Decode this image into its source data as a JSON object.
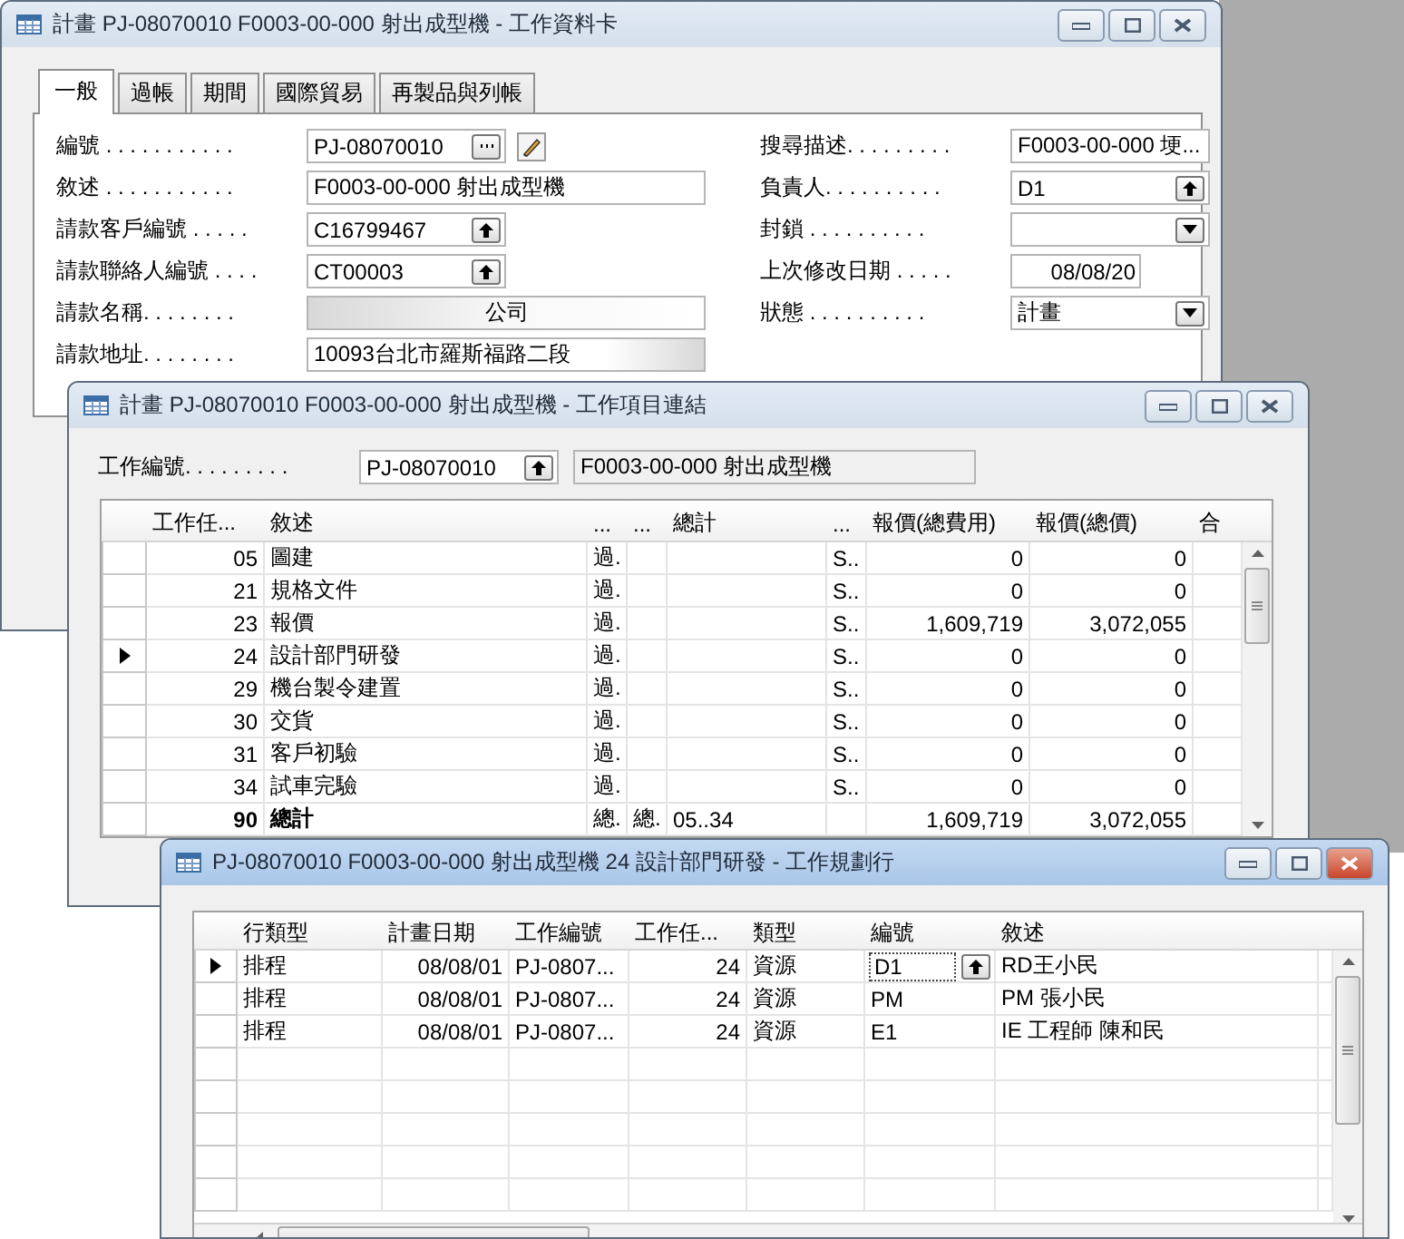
{
  "card_window": {
    "title": "計畫 PJ-08070010 F0003-00-000 射出成型機 - 工作資料卡",
    "active": false,
    "tabs": [
      {
        "label": "一般",
        "selected": true
      },
      {
        "label": "過帳",
        "selected": false
      },
      {
        "label": "期間",
        "selected": false
      },
      {
        "label": "國際貿易",
        "selected": false
      },
      {
        "label": "再製品與列帳",
        "selected": false
      }
    ],
    "left_fields": [
      {
        "label": "編號 . . . . . . . . . . .",
        "value": "PJ-08070010",
        "kind": "assist"
      },
      {
        "label": "敘述 . . . . . . . . . . .",
        "value": "F0003-00-000 射出成型機",
        "kind": "text"
      },
      {
        "label": "請款客戶編號 . . . . .",
        "value": "C16799467",
        "kind": "lookup"
      },
      {
        "label": "請款聯絡人編號 . . . .",
        "value": "CT00003",
        "kind": "lookup"
      },
      {
        "label": "請款名稱. . . . . . . .",
        "value": "公司",
        "kind": "readonly"
      },
      {
        "label": "請款地址. . . . . . . .",
        "value": "10093台北市羅斯福路二段",
        "kind": "text"
      }
    ],
    "right_fields": [
      {
        "label": "搜尋描述. . . . . . . . .",
        "value": "F0003-00-000 埂...",
        "kind": "text"
      },
      {
        "label": "負責人. . . . . . . . . .",
        "value": "D1",
        "kind": "lookup"
      },
      {
        "label": "封鎖 . . . . . . . . . .",
        "kind": "dropdown"
      },
      {
        "label": "上次修改日期 . . . . .",
        "value": "08/08/20",
        "kind": "date"
      },
      {
        "label": "狀態 . . . . . . . . . .",
        "value": "計畫",
        "kind": "dropdown"
      }
    ]
  },
  "lines_window": {
    "title": "計畫 PJ-08070010 F0003-00-000 射出成型機 - 工作項目連結",
    "active": false,
    "job_label": "工作編號. . . . . . . . .",
    "job_value": "PJ-08070010",
    "job_description": "F0003-00-000 射出成型機",
    "columns": [
      "工作任...",
      "敘述",
      "...",
      "...",
      "總計",
      "...",
      "報價(總費用)",
      "報價(總價)",
      "合"
    ],
    "rows": [
      {
        "cells": [
          "05",
          "圖建",
          "過.",
          null,
          null,
          "S..",
          "0",
          "0",
          null
        ],
        "current": false,
        "kind": "item"
      },
      {
        "cells": [
          "21",
          "規格文件",
          "過.",
          null,
          null,
          "S..",
          "0",
          "0",
          null
        ],
        "current": false,
        "kind": "item"
      },
      {
        "cells": [
          "23",
          "報價",
          "過.",
          null,
          null,
          "S..",
          "1,609,719",
          "3,072,055",
          null
        ],
        "current": false,
        "kind": "item"
      },
      {
        "cells": [
          "24",
          "設計部門研發",
          "過.",
          null,
          null,
          "S..",
          "0",
          "0",
          null
        ],
        "current": true,
        "kind": "item"
      },
      {
        "cells": [
          "29",
          "機台製令建置",
          "過.",
          null,
          null,
          "S..",
          "0",
          "0",
          null
        ],
        "current": false,
        "kind": "item"
      },
      {
        "cells": [
          "30",
          "交貨",
          "過.",
          null,
          null,
          "S..",
          "0",
          "0",
          null
        ],
        "current": false,
        "kind": "item"
      },
      {
        "cells": [
          "31",
          "客戶初驗",
          "過.",
          null,
          null,
          "S..",
          "0",
          "0",
          null
        ],
        "current": false,
        "kind": "item"
      },
      {
        "cells": [
          "34",
          "試車完驗",
          "過.",
          null,
          null,
          "S..",
          "0",
          "0",
          null
        ],
        "current": false,
        "kind": "item"
      },
      {
        "cells": [
          "90",
          "總計",
          "總.",
          "總.",
          "05..34",
          null,
          "1,609,719",
          "3,072,055",
          null
        ],
        "current": false,
        "kind": "total"
      }
    ]
  },
  "planning_window": {
    "title": "PJ-08070010 F0003-00-000 射出成型機 24 設計部門研發 - 工作規劃行",
    "active": true,
    "columns": [
      "行類型",
      "計畫日期",
      "工作編號",
      "工作任...",
      "類型",
      "編號",
      "敘述"
    ],
    "rows": [
      {
        "cells": [
          "排程",
          "08/08/01",
          "PJ-0807...",
          "24",
          "資源",
          "D1",
          "RD王小民"
        ],
        "current": true,
        "editing": true
      },
      {
        "cells": [
          "排程",
          "08/08/01",
          "PJ-0807...",
          "24",
          "資源",
          "PM",
          "PM 張小民"
        ],
        "current": false,
        "editing": false
      },
      {
        "cells": [
          "排程",
          "08/08/01",
          "PJ-0807...",
          "24",
          "資源",
          "E1",
          "IE 工程師 陳和民"
        ],
        "current": false,
        "editing": false
      }
    ]
  }
}
